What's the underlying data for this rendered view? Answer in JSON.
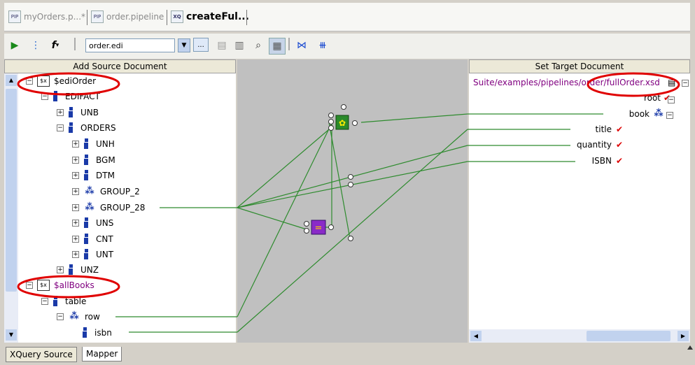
{
  "tabs": [
    {
      "label": "myOrders.p...*",
      "icon": "pipeline-file-icon",
      "active": false
    },
    {
      "label": "order.pipeline",
      "icon": "pipeline-file-icon",
      "active": false
    },
    {
      "label": "createFul...",
      "icon": "xquery-file-icon",
      "active": true
    }
  ],
  "toolbar": {
    "run_icon": "run-icon",
    "mapper_icon": "mapper-icon",
    "function_label": "f",
    "source_select_value": "order.edi",
    "browse_label": "..."
  },
  "left_panel": {
    "header": "Add Source Document",
    "nodes": [
      {
        "label": "$ediOrder",
        "type": "variable"
      },
      {
        "label": "EDIFACT",
        "type": "element"
      },
      {
        "label": "UNB",
        "type": "element"
      },
      {
        "label": "ORDERS",
        "type": "element"
      },
      {
        "label": "UNH",
        "type": "element"
      },
      {
        "label": "BGM",
        "type": "element"
      },
      {
        "label": "DTM",
        "type": "element"
      },
      {
        "label": "GROUP_2",
        "type": "group"
      },
      {
        "label": "GROUP_28",
        "type": "group"
      },
      {
        "label": "UNS",
        "type": "element"
      },
      {
        "label": "CNT",
        "type": "element"
      },
      {
        "label": "UNT",
        "type": "element"
      },
      {
        "label": "UNZ",
        "type": "element"
      },
      {
        "label": "$allBooks",
        "type": "variable"
      },
      {
        "label": "table",
        "type": "element"
      },
      {
        "label": "row",
        "type": "group"
      },
      {
        "label": "isbn",
        "type": "element"
      }
    ]
  },
  "right_panel": {
    "header": "Set Target Document",
    "path": "Suite/examples/pipelines/order/fullOrder.xsd",
    "nodes": [
      {
        "label": "root"
      },
      {
        "label": "book"
      },
      {
        "label": "title"
      },
      {
        "label": "quantity"
      },
      {
        "label": "ISBN"
      }
    ]
  },
  "bottom_tabs": [
    {
      "label": "XQuery Source"
    },
    {
      "label": "Mapper"
    }
  ],
  "colors": {
    "link_line": "#2e8b2e",
    "highlight": "#e00000",
    "variable_text": "#800080"
  }
}
